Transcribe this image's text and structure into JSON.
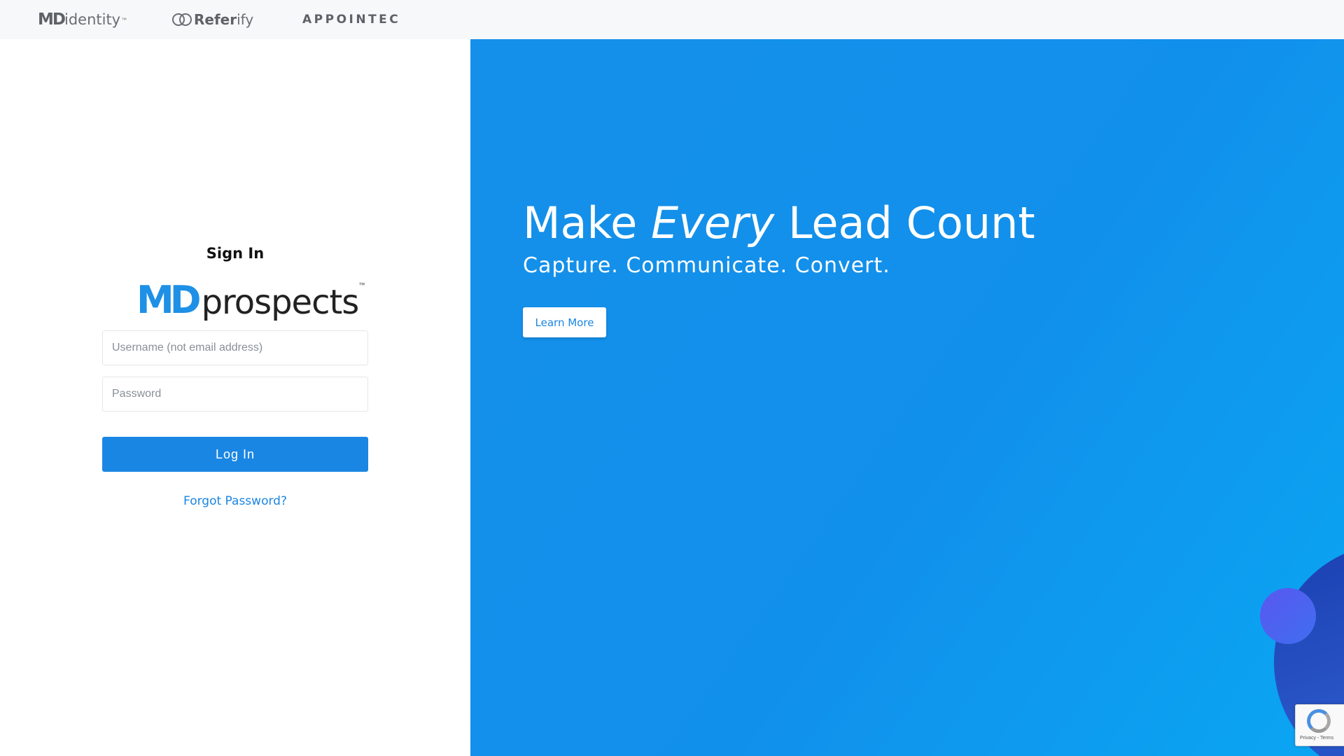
{
  "topbar": {
    "brands": [
      {
        "md": "MD",
        "rest": "identity",
        "tm": "™"
      },
      {
        "bold": "Refer",
        "rest": "ify"
      },
      {
        "text": "APPOINTEC"
      }
    ]
  },
  "signin": {
    "title": "Sign In",
    "logo": {
      "md": "MD",
      "rest": "prospects",
      "tm": "™"
    },
    "username_placeholder": "Username (not email address)",
    "password_placeholder": "Password",
    "login_label": "Log In",
    "forgot_label": "Forgot Password?"
  },
  "hero": {
    "title_part1": "Make ",
    "title_em": "Every",
    "title_part2": " Lead Count",
    "subtitle": "Capture. Communicate. Convert.",
    "learn_more_label": "Learn More"
  },
  "recaptcha": {
    "text": "Privacy - Terms"
  },
  "colors": {
    "accent": "#1a86e3",
    "hero_bg": "#1190eb",
    "topbar_bg": "#f7f8fa"
  },
  "icons": [
    "referify-rings-icon",
    "recaptcha-icon"
  ]
}
